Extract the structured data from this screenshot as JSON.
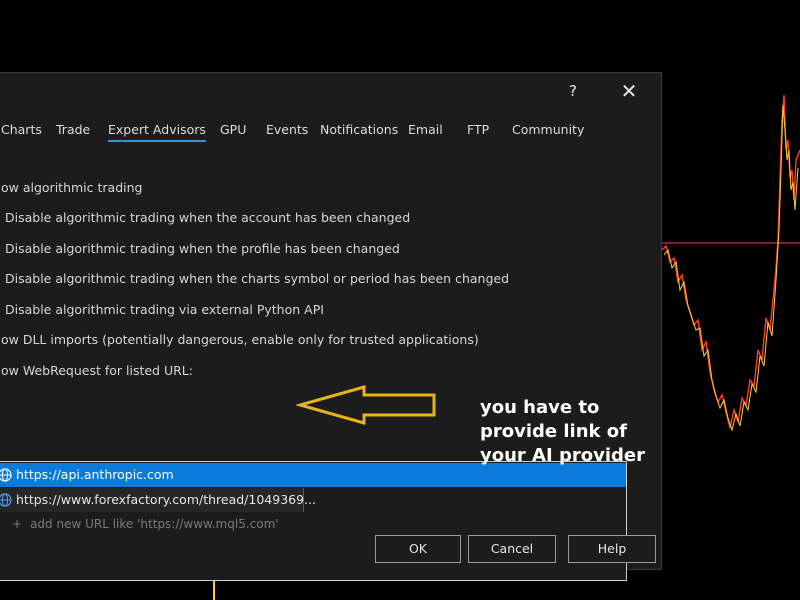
{
  "dialog": {
    "help_label": "?",
    "close_label": "✕",
    "tabs": [
      "Charts",
      "Trade",
      "Expert Advisors",
      "GPU",
      "Events",
      "Notifications",
      "Email",
      "FTP",
      "Community"
    ],
    "active_tab": "Expert Advisors"
  },
  "options": {
    "allow_algo": "ow algorithmic trading",
    "disable_account": "Disable algorithmic trading when the account has been changed",
    "disable_profile": "Disable algorithmic trading when the profile has been changed",
    "disable_symbol": "Disable algorithmic trading when the charts symbol or period has been changed",
    "disable_python": "Disable algorithmic trading via external Python API",
    "allow_dll": "ow DLL imports (potentially dangerous, enable only for trusted applications)",
    "allow_webrequest": "ow WebRequest for listed URL:"
  },
  "urls": {
    "items": [
      "https://api.anthropic.com",
      "https://www.forexfactory.com/thread/1049369..."
    ],
    "add_placeholder": "add new URL like 'https://www.mql5.com'",
    "add_symbol": "+"
  },
  "annotation": {
    "lines": [
      "you have to",
      "provide link of",
      "your AI provider"
    ],
    "arrow_color": "#e8b41c"
  },
  "buttons": {
    "ok": "OK",
    "cancel": "Cancel",
    "help": "Help"
  },
  "colors": {
    "dialog_bg": "#1c1c1c",
    "selection": "#0a7bd8",
    "tab_underline": "#3d8fd6",
    "chart_line": "#ff3b30",
    "chart_line_alt": "#ffcc33",
    "price_line": "#c8344a"
  }
}
